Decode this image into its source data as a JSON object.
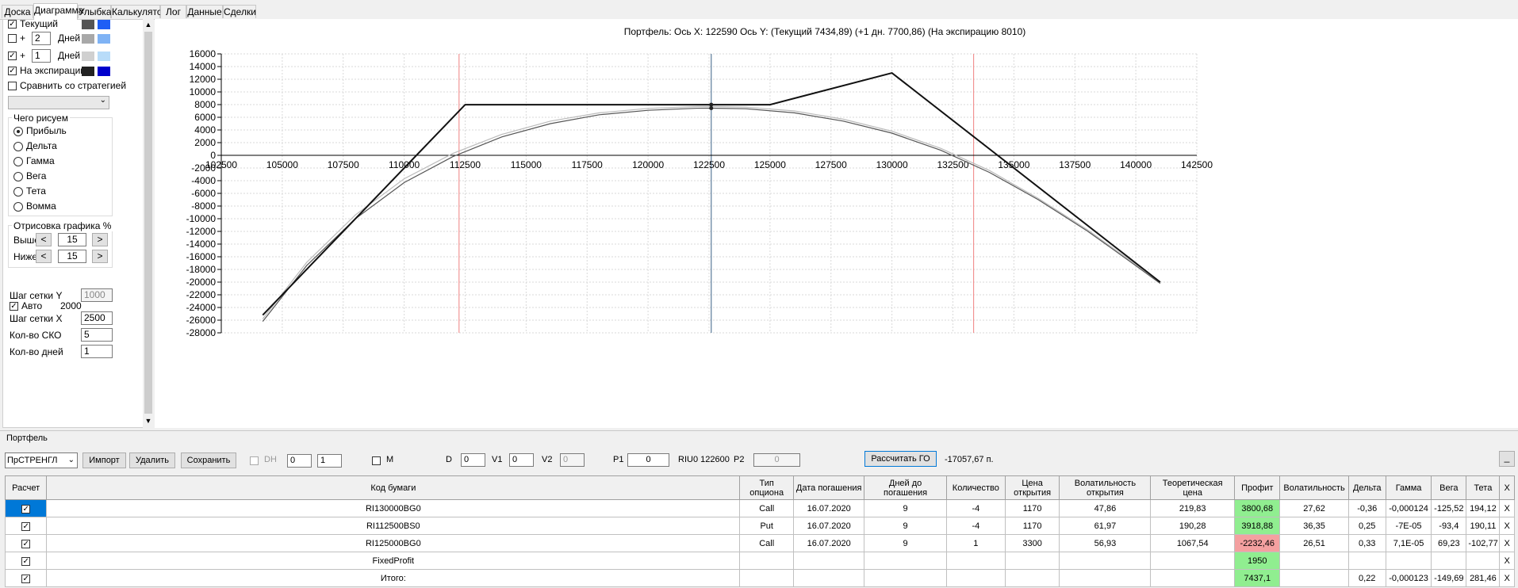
{
  "tabs": [
    "Доска",
    "Диаграмма",
    "Улыбка",
    "Калькулятор",
    "Лог",
    "Данные",
    "Сделки"
  ],
  "active_tab": "Диаграмма",
  "left_panel": {
    "current_label": "Текущий",
    "plus": "+",
    "days_label": "Дней",
    "days1": "2",
    "days2": "1",
    "expiry_label": "На экспирацию",
    "compare_label": "Сравнить со стратегией",
    "what_title": "Чего рисуем",
    "radios": [
      "Прибыль",
      "Дельта",
      "Гамма",
      "Вега",
      "Тета",
      "Вомма"
    ],
    "draw_title": "Отрисовка графика %",
    "above_label": "Выше",
    "below_label": "Ниже",
    "above_value": "15",
    "below_value": "15",
    "left_arrow": "<",
    "right_arrow": ">",
    "grid_y_label": "Шаг сетки Y",
    "grid_y_value": "1000",
    "auto_label": "Авто",
    "auto_value": "2000",
    "grid_x_label": "Шаг сетки X",
    "grid_x_value": "2500",
    "sko_label": "Кол-во СКО",
    "sko_value": "5",
    "days_count_label": "Кол-во дней",
    "days_count_value": "1",
    "colors": {
      "current": [
        "#555555",
        "#1e5ef5"
      ],
      "days2": [
        "#a8a8a8",
        "#7fb3f5"
      ],
      "days1": [
        "#d0d0d0",
        "#b8dcf9"
      ],
      "expiry": [
        "#222222",
        "#0000cc"
      ]
    }
  },
  "chart_data": {
    "type": "line",
    "title": "Портфель: Ось X: 122590 Ось Y:  (Текущий 7434,89)  (+1 дн. 7700,86)  (На экспирацию 8010)",
    "xlim": [
      102500,
      142500
    ],
    "ylim": [
      -28000,
      16000
    ],
    "x_ticks": [
      102500,
      105000,
      107500,
      110000,
      112500,
      115000,
      117500,
      120000,
      122500,
      125000,
      127500,
      130000,
      132500,
      135000,
      137500,
      140000,
      142500
    ],
    "y_ticks": [
      16000,
      14000,
      12000,
      10000,
      8000,
      6000,
      4000,
      2000,
      0,
      -2000,
      -4000,
      -6000,
      -8000,
      -10000,
      -12000,
      -14000,
      -16000,
      -18000,
      -20000,
      -22000,
      -24000,
      -26000,
      -28000
    ],
    "grid": true,
    "cursor_x": 122590,
    "red_lines_x": [
      112250,
      133350
    ],
    "series": [
      {
        "color": "#111111",
        "x": [
          104200,
          112500,
          125000,
          130000,
          141000
        ],
        "y": [
          -25200,
          7990,
          7990,
          12990,
          -20000
        ]
      },
      {
        "color": "#555555",
        "x": [
          104200,
          106000,
          108000,
          110000,
          112000,
          114000,
          116000,
          118000,
          120000,
          122000,
          122590,
          124000,
          126000,
          128000,
          130000,
          132000,
          134000,
          136000,
          138000,
          140000,
          141000
        ],
        "y": [
          -26200,
          -17400,
          -10000,
          -4300,
          -200,
          2900,
          5000,
          6400,
          7100,
          7430,
          7435,
          7350,
          6700,
          5400,
          3500,
          800,
          -2700,
          -7000,
          -11900,
          -17400,
          -20200
        ]
      },
      {
        "color": "#bbbbbb",
        "x": [
          104200,
          106000,
          108000,
          110000,
          112000,
          114000,
          116000,
          118000,
          120000,
          122000,
          122590,
          124000,
          126000,
          128000,
          130000,
          132000,
          134000,
          136000,
          138000,
          140000,
          141000
        ],
        "y": [
          -25800,
          -16900,
          -9400,
          -3700,
          300,
          3300,
          5400,
          6700,
          7400,
          7690,
          7700,
          7600,
          7000,
          5700,
          3800,
          1100,
          -2400,
          -6800,
          -11700,
          -17200,
          -20000
        ]
      }
    ],
    "points": [
      {
        "x": 122590,
        "y": 7990
      },
      {
        "x": 122590,
        "y": 7434.89
      }
    ]
  },
  "portfolio": {
    "header_label": "Портфель",
    "strategy": "ПрСТРЕНГЛ",
    "import_btn": "Импорт",
    "delete_btn": "Удалить",
    "save_btn": "Сохранить",
    "dh_label": "DH",
    "dh_val1": "0",
    "dh_val2": "1",
    "m_label": "M",
    "d_label": "D",
    "d_value": "0",
    "v1_label": "V1",
    "v1_value": "0",
    "v2_label": "V2",
    "v2_value": "0",
    "p1_label": "P1",
    "p1_value": "0",
    "riu_text": "RIU0 122600",
    "p2_label": "P2",
    "p2_value": "0",
    "calc_btn": "Рассчитать ГО",
    "go_value": "-17057,67 п.",
    "minimize": "_",
    "columns": [
      "Расчет",
      "Код бумаги",
      "Тип опциона",
      "Дата погашения",
      "Дней до погашения",
      "Количество",
      "Цена открытия",
      "Волатильность открытия",
      "Теоретическая цена",
      "Профит",
      "Волатильность",
      "Дельта",
      "Гамма",
      "Вега",
      "Тета",
      "X"
    ],
    "rows": [
      [
        "✓",
        "RI130000BG0",
        "Call",
        "16.07.2020",
        "9",
        "-4",
        "1170",
        "47,86",
        "219,83",
        "3800,68",
        "27,62",
        "-0,36",
        "-0,000124",
        "-125,52",
        "194,12",
        "X"
      ],
      [
        "✓",
        "RI112500BS0",
        "Put",
        "16.07.2020",
        "9",
        "-4",
        "1170",
        "61,97",
        "190,28",
        "3918,88",
        "36,35",
        "0,25",
        "-7E-05",
        "-93,4",
        "190,11",
        "X"
      ],
      [
        "✓",
        "RI125000BG0",
        "Call",
        "16.07.2020",
        "9",
        "1",
        "3300",
        "56,93",
        "1067,54",
        "-2232,46",
        "26,51",
        "0,33",
        "7,1E-05",
        "69,23",
        "-102,77",
        "X"
      ],
      [
        "✓",
        "FixedProfit",
        "",
        "",
        "",
        "",
        "",
        "",
        "",
        "1950",
        "",
        "",
        "",
        "",
        "",
        "X"
      ],
      [
        "✓",
        "Итого:",
        "",
        "",
        "",
        "",
        "",
        "",
        "",
        "7437,1",
        "",
        "0,22",
        "-0,000123",
        "-149,69",
        "281,46",
        "X"
      ]
    ],
    "profit_colors": [
      "green",
      "green",
      "red",
      "green",
      "green"
    ]
  }
}
